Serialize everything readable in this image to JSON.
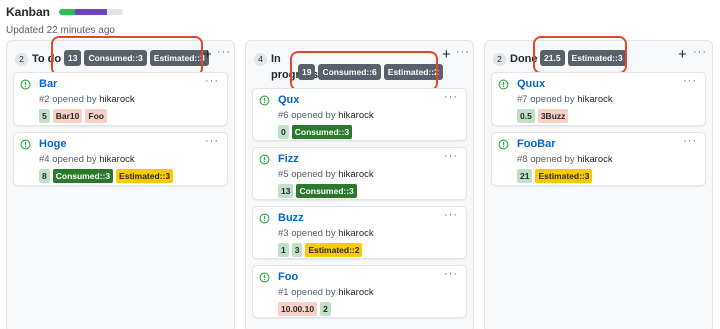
{
  "header": {
    "title": "Kanban",
    "updated": "Updated 22 minutes ago",
    "progress": {
      "done_fraction": 0.25,
      "in_progress_fraction": 0.5
    }
  },
  "colors": {
    "annotation": "#e8462a",
    "link": "#0366d6",
    "badge_bg": "#586069",
    "label_green_light": "#c2e0c6",
    "label_pink": "#f9d0c4",
    "label_green_dark": "#2b7a2b",
    "label_yellow": "#fbca04"
  },
  "columns": [
    {
      "count": "2",
      "name": "To do",
      "badges": [
        "13",
        "Consumed::3",
        "Estimated::3"
      ],
      "cards": [
        {
          "title": "Bar",
          "number": "#2",
          "opened_by": "opened by",
          "author": "hikarock",
          "labels": [
            {
              "text": "5",
              "style": "green-light"
            },
            {
              "text": "Bar10",
              "style": "pink"
            },
            {
              "text": "Foo",
              "style": "pink"
            }
          ]
        },
        {
          "title": "Hoge",
          "number": "#4",
          "opened_by": "opened by",
          "author": "hikarock",
          "labels": [
            {
              "text": "8",
              "style": "green-light"
            },
            {
              "text": "Consumed::3",
              "style": "green-dark"
            },
            {
              "text": "Estimated::3",
              "style": "yellow"
            }
          ]
        }
      ]
    },
    {
      "count": "4",
      "name": "In progress",
      "badges": [
        "19",
        "Consumed::6",
        "Estimated::2"
      ],
      "cards": [
        {
          "title": "Qux",
          "number": "#6",
          "opened_by": "opened by",
          "author": "hikarock",
          "labels": [
            {
              "text": "0",
              "style": "green-light"
            },
            {
              "text": "Consumed::3",
              "style": "green-dark"
            }
          ]
        },
        {
          "title": "Fizz",
          "number": "#5",
          "opened_by": "opened by",
          "author": "hikarock",
          "labels": [
            {
              "text": "13",
              "style": "green-light"
            },
            {
              "text": "Consumed::3",
              "style": "green-dark"
            }
          ]
        },
        {
          "title": "Buzz",
          "number": "#3",
          "opened_by": "opened by",
          "author": "hikarock",
          "labels": [
            {
              "text": "1",
              "style": "green-light"
            },
            {
              "text": "3",
              "style": "green-light"
            },
            {
              "text": "Estimated::2",
              "style": "yellow"
            }
          ]
        },
        {
          "title": "Foo",
          "number": "#1",
          "opened_by": "opened by",
          "author": "hikarock",
          "labels": [
            {
              "text": "10.00.10",
              "style": "pink"
            },
            {
              "text": "2",
              "style": "green-light"
            }
          ]
        }
      ]
    },
    {
      "count": "2",
      "name": "Done",
      "badges": [
        "21.5",
        "Estimated::3"
      ],
      "cards": [
        {
          "title": "Quux",
          "number": "#7",
          "opened_by": "opened by",
          "author": "hikarock",
          "labels": [
            {
              "text": "0.5",
              "style": "green-light"
            },
            {
              "text": "3Buzz",
              "style": "pink"
            }
          ]
        },
        {
          "title": "FooBar",
          "number": "#8",
          "opened_by": "opened by",
          "author": "hikarock",
          "labels": [
            {
              "text": "21",
              "style": "green-light"
            },
            {
              "text": "Estimated::3",
              "style": "yellow"
            }
          ]
        }
      ]
    }
  ],
  "icons": {
    "open_issue": "issue-opened-icon",
    "add": "plus-icon",
    "more": "kebab-horizontal-icon"
  },
  "glyphs": {
    "plus": "+",
    "more": "···"
  }
}
